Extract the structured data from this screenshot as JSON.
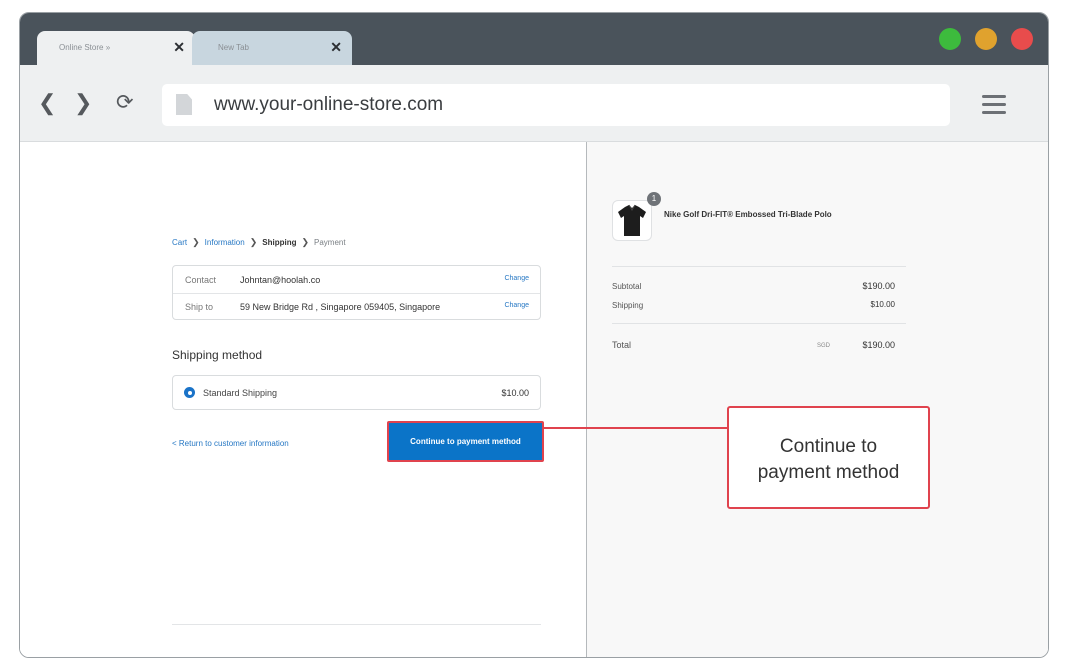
{
  "browser": {
    "tabs": [
      {
        "label": "Online Store  »",
        "close": "✕"
      },
      {
        "label": "New Tab",
        "close": "✕"
      }
    ],
    "url": "www.your-online-store.com",
    "colors": {
      "green": "#3dbb3d",
      "yellow": "#e0a22e",
      "red": "#e84c4c"
    }
  },
  "checkout": {
    "breadcrumb": [
      "Cart",
      "Information",
      "Shipping",
      "Payment"
    ],
    "contact": {
      "label": "Contact",
      "value": "Johntan@hoolah.co",
      "change": "Change"
    },
    "ship_to": {
      "label": "Ship to",
      "value": "59 New Bridge Rd , Singapore 059405, Singapore",
      "change": "Change"
    },
    "shipping_title": "Shipping method",
    "shipping_option": {
      "name": "Standard Shipping",
      "price": "$10.00",
      "selected": true
    },
    "return_link": "< Return to customer information",
    "continue_button": "Continue to payment method"
  },
  "summary": {
    "product": {
      "name": "Nike Golf Dri-FIT® Embossed Tri-Blade Polo",
      "qty": "1"
    },
    "subtotal": {
      "label": "Subtotal",
      "value": "$190.00"
    },
    "shipping": {
      "label": "Shipping",
      "value": "$10.00"
    },
    "total": {
      "label": "Total",
      "currency": "SGD",
      "value": "$190.00"
    }
  },
  "callout": {
    "line1": "Continue to",
    "line2": "payment method",
    "color": "#e0434e"
  }
}
